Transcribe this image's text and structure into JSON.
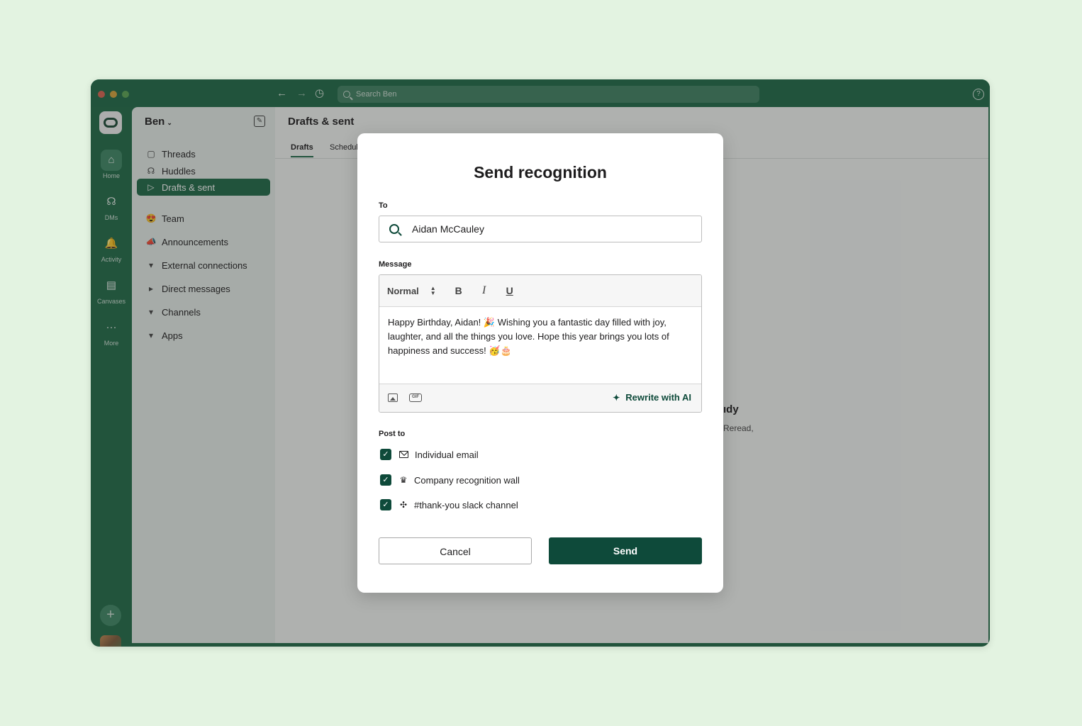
{
  "titlebar": {
    "search_placeholder": "Search Ben",
    "back_icon": "←",
    "forward_icon": "→",
    "history_icon": "◷",
    "help_icon": "?"
  },
  "rail": {
    "items": [
      {
        "label": "Home",
        "icon": "home-icon",
        "glyph": "⌂"
      },
      {
        "label": "DMs",
        "icon": "dm-icon",
        "glyph": "☊"
      },
      {
        "label": "Activity",
        "icon": "bell-icon",
        "glyph": "🔔"
      },
      {
        "label": "Canvases",
        "icon": "canvas-icon",
        "glyph": "▤"
      },
      {
        "label": "More",
        "icon": "more-icon",
        "glyph": "···"
      }
    ],
    "add_glyph": "+"
  },
  "sidebar": {
    "workspace": "Ben",
    "workspace_chevron": "⌄",
    "compose_glyph": "✎",
    "items": [
      {
        "label": "Threads",
        "glyph": "▢"
      },
      {
        "label": "Huddles",
        "glyph": "☊"
      },
      {
        "label": "Drafts & sent",
        "glyph": "▷"
      },
      {
        "label": "Team",
        "glyph": "😍"
      },
      {
        "label": "Announcements",
        "glyph": "📣"
      },
      {
        "label": "External connections",
        "glyph": "▾"
      },
      {
        "label": "Direct messages",
        "glyph": "▸"
      },
      {
        "label": "Channels",
        "glyph": "▾"
      },
      {
        "label": "Apps",
        "glyph": "▾"
      }
    ]
  },
  "main": {
    "title": "Drafts & sent",
    "tabs": [
      "Drafts",
      "Schedul"
    ],
    "empty_title_fragment": "ıdy",
    "empty_sub_fragment": "Reread,"
  },
  "modal": {
    "title": "Send recognition",
    "to_label": "To",
    "to_value": "Aidan McCauley",
    "message_label": "Message",
    "format_select": "Normal",
    "format_arrows": "▲▼",
    "bold": "B",
    "italic": "I",
    "underline": "U",
    "message_body": "Happy Birthday, Aidan! 🎉 Wishing you a fantastic day filled with joy, laughter, and all the things you love. Hope this year brings you lots of happiness and success! 🥳🎂",
    "gif_label": "GIF",
    "rewrite_label": "Rewrite with AI",
    "rewrite_glyph": "✦",
    "post_to_label": "Post to",
    "post_options": [
      {
        "label": "Individual email",
        "checked": true,
        "icon": "mail-icon",
        "glyph": ""
      },
      {
        "label": "Company recognition wall",
        "checked": true,
        "icon": "award-icon",
        "glyph": "♛"
      },
      {
        "label": "#thank-you slack channel",
        "checked": true,
        "icon": "slack-icon",
        "glyph": "✣"
      }
    ],
    "check_glyph": "✓",
    "cancel_label": "Cancel",
    "send_label": "Send"
  },
  "colors": {
    "brand_green": "#1e6a46",
    "dark_green": "#0e4a3a",
    "page_bg": "#e3f3e1"
  }
}
